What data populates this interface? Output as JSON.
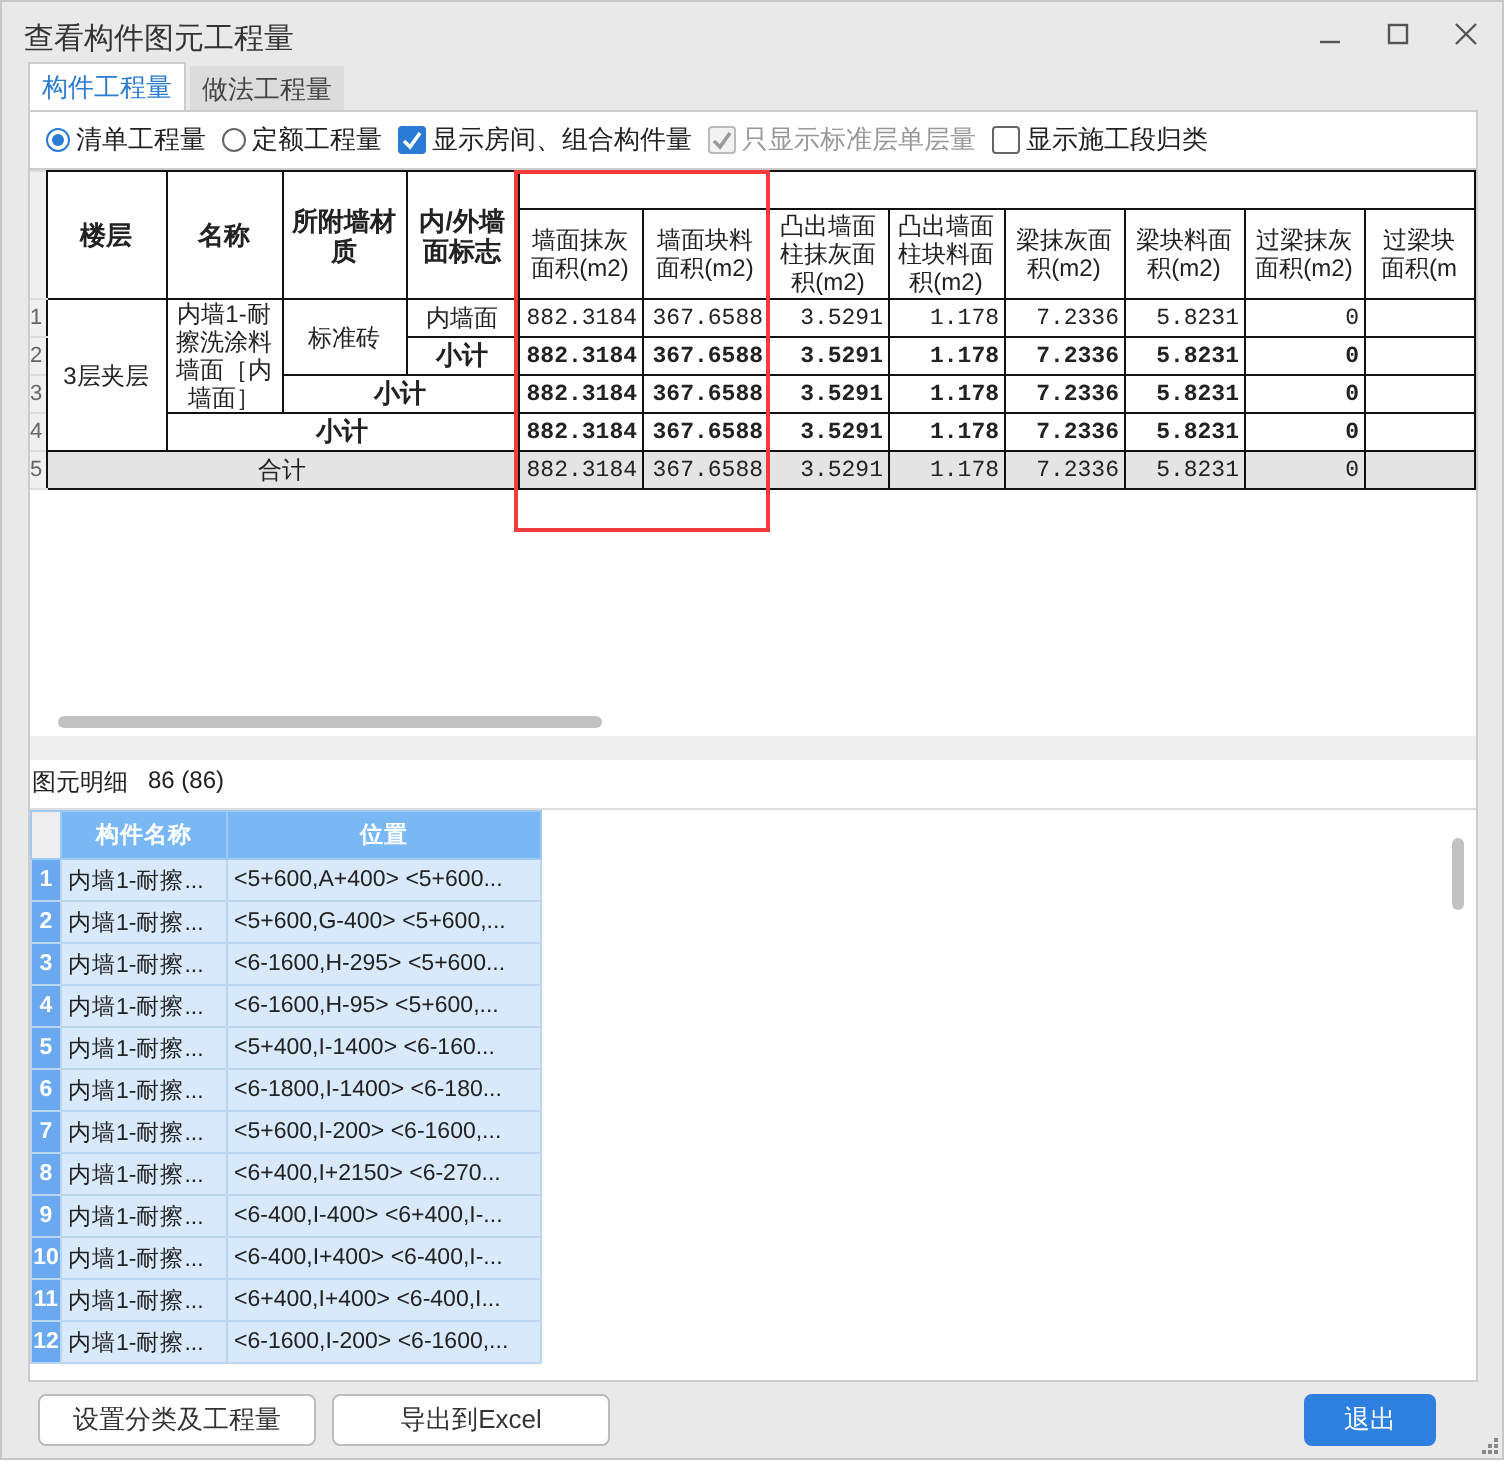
{
  "window": {
    "title": "查看构件图元工程量"
  },
  "tabs": [
    {
      "label": "构件工程量",
      "selected": true
    },
    {
      "label": "做法工程量",
      "selected": false
    }
  ],
  "options": [
    {
      "kind": "radio",
      "label": "清单工程量",
      "selected": true
    },
    {
      "kind": "radio",
      "label": "定额工程量",
      "selected": false
    },
    {
      "kind": "checkbox",
      "label": "显示房间、组合构件量",
      "checked": true,
      "disabled": false
    },
    {
      "kind": "checkbox",
      "label": "只显示标准层单层量",
      "checked": true,
      "disabled": true
    },
    {
      "kind": "checkbox",
      "label": "显示施工段归类",
      "checked": false,
      "disabled": false
    }
  ],
  "quantity_table": {
    "columns": [
      {
        "kind": "key",
        "label_lines": [
          "楼层"
        ]
      },
      {
        "kind": "key",
        "label_lines": [
          "名称"
        ]
      },
      {
        "kind": "key",
        "label_lines": [
          "所附墙材",
          "质"
        ]
      },
      {
        "kind": "key",
        "label_lines": [
          "内/外墙",
          "面标志"
        ]
      },
      {
        "kind": "measure",
        "label_lines": [
          "墙面抹灰",
          "面积(m2)"
        ]
      },
      {
        "kind": "measure",
        "label_lines": [
          "墙面块料",
          "面积(m2)"
        ]
      },
      {
        "kind": "measure",
        "label_lines": [
          "凸出墙面",
          "柱抹灰面",
          "积(m2)"
        ]
      },
      {
        "kind": "measure",
        "label_lines": [
          "凸出墙面",
          "柱块料面",
          "积(m2)"
        ]
      },
      {
        "kind": "measure",
        "label_lines": [
          "梁抹灰面",
          "积(m2)"
        ]
      },
      {
        "kind": "measure",
        "label_lines": [
          "梁块料面",
          "积(m2)"
        ]
      },
      {
        "kind": "measure",
        "label_lines": [
          "过梁抹灰",
          "面积(m2)"
        ]
      },
      {
        "kind": "measure",
        "label_lines": [
          "过梁块",
          "面积(m"
        ]
      }
    ],
    "rows": [
      {
        "number": "1",
        "total": false,
        "cells": [
          {
            "text": "3层夹层",
            "rowspan": 4,
            "bold": false,
            "kind": "text"
          },
          {
            "text": "内墙1-耐擦洗涂料墙面［内墙面］",
            "rowspan": 3,
            "bold": false,
            "kind": "text"
          },
          {
            "text": "标准砖",
            "rowspan": 2,
            "bold": false,
            "kind": "text"
          },
          {
            "text": "内墙面",
            "bold": false,
            "kind": "text"
          },
          {
            "text": "882.3184",
            "bold": false,
            "kind": "number"
          },
          {
            "text": "367.6588",
            "bold": false,
            "kind": "number"
          },
          {
            "text": "3.5291",
            "bold": false,
            "kind": "number"
          },
          {
            "text": "1.178",
            "bold": false,
            "kind": "number"
          },
          {
            "text": "7.2336",
            "bold": false,
            "kind": "number"
          },
          {
            "text": "5.8231",
            "bold": false,
            "kind": "number"
          },
          {
            "text": "0",
            "bold": false,
            "kind": "number"
          }
        ]
      },
      {
        "number": "2",
        "total": false,
        "cells": [
          {
            "text": "小计",
            "bold": true,
            "kind": "text"
          },
          {
            "text": "882.3184",
            "bold": true,
            "kind": "number"
          },
          {
            "text": "367.6588",
            "bold": true,
            "kind": "number"
          },
          {
            "text": "3.5291",
            "bold": true,
            "kind": "number"
          },
          {
            "text": "1.178",
            "bold": true,
            "kind": "number"
          },
          {
            "text": "7.2336",
            "bold": true,
            "kind": "number"
          },
          {
            "text": "5.8231",
            "bold": true,
            "kind": "number"
          },
          {
            "text": "0",
            "bold": true,
            "kind": "number"
          }
        ]
      },
      {
        "number": "3",
        "total": false,
        "cells": [
          {
            "text": "小计",
            "colspan": 2,
            "bold": true,
            "kind": "text"
          },
          {
            "text": "882.3184",
            "bold": true,
            "kind": "number"
          },
          {
            "text": "367.6588",
            "bold": true,
            "kind": "number"
          },
          {
            "text": "3.5291",
            "bold": true,
            "kind": "number"
          },
          {
            "text": "1.178",
            "bold": true,
            "kind": "number"
          },
          {
            "text": "7.2336",
            "bold": true,
            "kind": "number"
          },
          {
            "text": "5.8231",
            "bold": true,
            "kind": "number"
          },
          {
            "text": "0",
            "bold": true,
            "kind": "number"
          }
        ]
      },
      {
        "number": "4",
        "total": false,
        "cells": [
          {
            "text": "小计",
            "colspan": 3,
            "bold": true,
            "kind": "text"
          },
          {
            "text": "882.3184",
            "bold": true,
            "kind": "number"
          },
          {
            "text": "367.6588",
            "bold": true,
            "kind": "number"
          },
          {
            "text": "3.5291",
            "bold": true,
            "kind": "number"
          },
          {
            "text": "1.178",
            "bold": true,
            "kind": "number"
          },
          {
            "text": "7.2336",
            "bold": true,
            "kind": "number"
          },
          {
            "text": "5.8231",
            "bold": true,
            "kind": "number"
          },
          {
            "text": "0",
            "bold": true,
            "kind": "number"
          }
        ]
      },
      {
        "number": "5",
        "total": true,
        "cells": [
          {
            "text": "合计",
            "colspan": 4,
            "bold": false,
            "kind": "text"
          },
          {
            "text": "882.3184",
            "bold": false,
            "kind": "number"
          },
          {
            "text": "367.6588",
            "bold": false,
            "kind": "number"
          },
          {
            "text": "3.5291",
            "bold": false,
            "kind": "number"
          },
          {
            "text": "1.178",
            "bold": false,
            "kind": "number"
          },
          {
            "text": "7.2336",
            "bold": false,
            "kind": "number"
          },
          {
            "text": "5.8231",
            "bold": false,
            "kind": "number"
          },
          {
            "text": "0",
            "bold": false,
            "kind": "number"
          }
        ]
      }
    ]
  },
  "detail": {
    "title": "图元明细",
    "count": "86 (86)",
    "columns": [
      "构件名称",
      "位置"
    ],
    "rows": [
      {
        "number": "1",
        "name": "内墙1-耐擦...",
        "position": "<5+600,A+400> <5+600..."
      },
      {
        "number": "2",
        "name": "内墙1-耐擦...",
        "position": "<5+600,G-400> <5+600,..."
      },
      {
        "number": "3",
        "name": "内墙1-耐擦...",
        "position": "<6-1600,H-295> <5+600..."
      },
      {
        "number": "4",
        "name": "内墙1-耐擦...",
        "position": "<6-1600,H-95> <5+600,..."
      },
      {
        "number": "5",
        "name": "内墙1-耐擦...",
        "position": "<5+400,I-1400> <6-160..."
      },
      {
        "number": "6",
        "name": "内墙1-耐擦...",
        "position": "<6-1800,I-1400> <6-180..."
      },
      {
        "number": "7",
        "name": "内墙1-耐擦...",
        "position": "<5+600,I-200> <6-1600,..."
      },
      {
        "number": "8",
        "name": "内墙1-耐擦...",
        "position": "<6+400,I+2150> <6-270..."
      },
      {
        "number": "9",
        "name": "内墙1-耐擦...",
        "position": "<6-400,I-400> <6+400,I-..."
      },
      {
        "number": "10",
        "name": "内墙1-耐擦...",
        "position": "<6-400,I+400> <6-400,I-..."
      },
      {
        "number": "11",
        "name": "内墙1-耐擦...",
        "position": "<6+400,I+400> <6-400,I..."
      },
      {
        "number": "12",
        "name": "内墙1-耐擦...",
        "position": "<6-1600,I-200> <6-1600,..."
      }
    ]
  },
  "buttons": [
    {
      "label": "设置分类及工程量",
      "kind": "default"
    },
    {
      "label": "导出到Excel",
      "kind": "default"
    },
    {
      "label": "退出",
      "kind": "primary"
    }
  ]
}
